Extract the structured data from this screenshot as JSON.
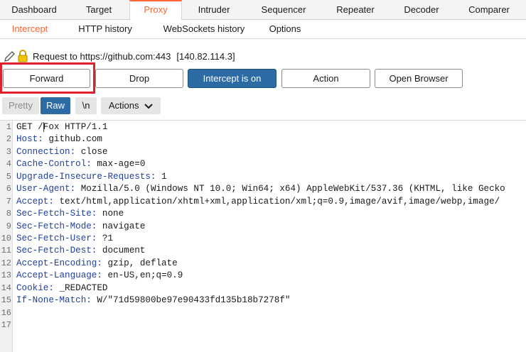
{
  "top_tabs": [
    "Dashboard",
    "Target",
    "Proxy",
    "Intruder",
    "Sequencer",
    "Repeater",
    "Decoder",
    "Comparer"
  ],
  "active_top_tab": "Proxy",
  "sub_tabs": [
    "Intercept",
    "HTTP history",
    "WebSockets history",
    "Options"
  ],
  "active_sub_tab": "Intercept",
  "request_info": {
    "label": "Request to https://github.com:443",
    "ip": "[140.82.114.3]"
  },
  "buttons": {
    "forward": "Forward",
    "drop": "Drop",
    "intercept": "Intercept is on",
    "action": "Action",
    "open_browser": "Open Browser"
  },
  "editor_toolbar": {
    "pretty": "Pretty",
    "raw": "Raw",
    "newline": "\\n",
    "actions": "Actions"
  },
  "colors": {
    "accent": "#ff6633",
    "primary_button": "#2d6ba4",
    "highlight": "#e0202a",
    "header_name": "#1f3f9e"
  },
  "request_lines": [
    {
      "n": "1",
      "name": "",
      "value": "GET /Fox HTTP/1.1"
    },
    {
      "n": "2",
      "name": "Host",
      "value": " github.com"
    },
    {
      "n": "3",
      "name": "Connection",
      "value": " close"
    },
    {
      "n": "4",
      "name": "Cache-Control",
      "value": " max-age=0"
    },
    {
      "n": "5",
      "name": "Upgrade-Insecure-Requests",
      "value": " 1"
    },
    {
      "n": "6",
      "name": "User-Agent",
      "value": " Mozilla/5.0 (Windows NT 10.0; Win64; x64) AppleWebKit/537.36 (KHTML, like Gecko"
    },
    {
      "n": "7",
      "name": "Accept",
      "value": " text/html,application/xhtml+xml,application/xml;q=0.9,image/avif,image/webp,image/"
    },
    {
      "n": "8",
      "name": "Sec-Fetch-Site",
      "value": " none"
    },
    {
      "n": "9",
      "name": "Sec-Fetch-Mode",
      "value": " navigate"
    },
    {
      "n": "10",
      "name": "Sec-Fetch-User",
      "value": " ?1"
    },
    {
      "n": "11",
      "name": "Sec-Fetch-Dest",
      "value": " document"
    },
    {
      "n": "12",
      "name": "Accept-Encoding",
      "value": " gzip, deflate"
    },
    {
      "n": "13",
      "name": "Accept-Language",
      "value": " en-US,en;q=0.9"
    },
    {
      "n": "14",
      "name": "Cookie",
      "value": " _REDACTED"
    },
    {
      "n": "15",
      "name": "If-None-Match",
      "value": " W/\"71d59800be97e90433fd135b18b7278f\""
    },
    {
      "n": "16",
      "name": "",
      "value": ""
    },
    {
      "n": "17",
      "name": "",
      "value": ""
    }
  ]
}
